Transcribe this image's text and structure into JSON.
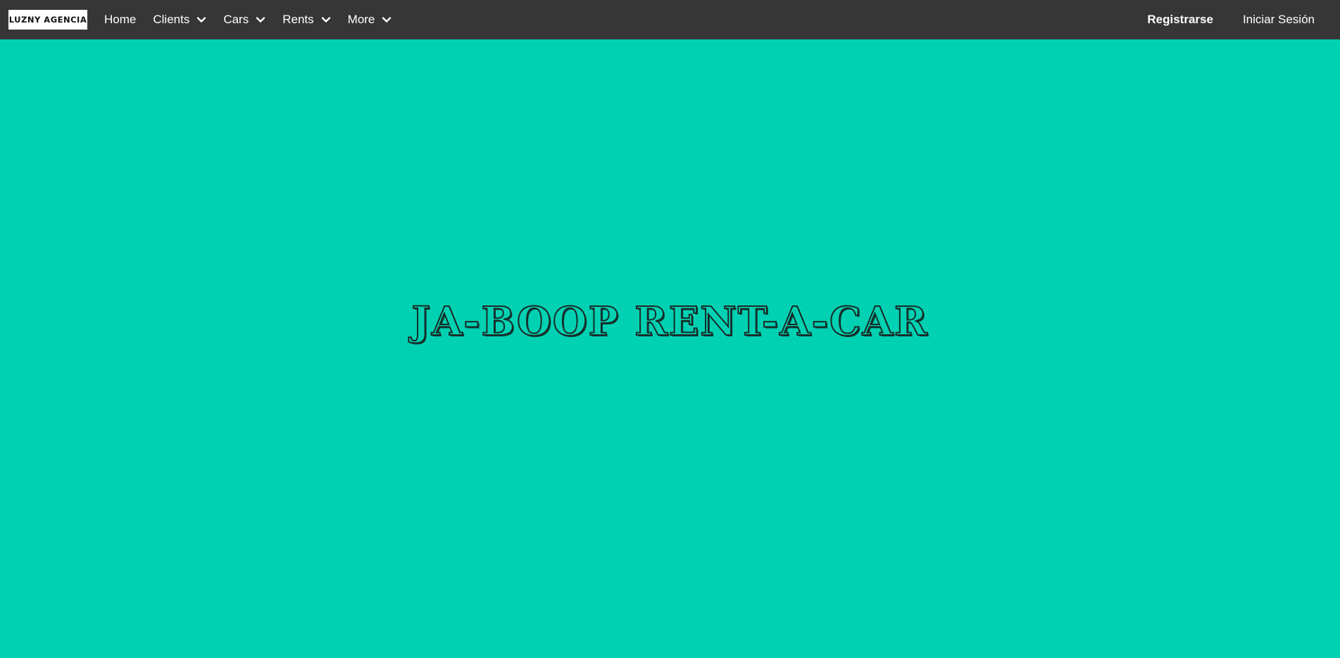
{
  "navbar": {
    "brand_label": "LUZNY AGENCIA",
    "items": [
      {
        "label": "Home",
        "has_dropdown": false
      },
      {
        "label": "Clients",
        "has_dropdown": true,
        "icon": "chevron-down-icon"
      },
      {
        "label": "Cars",
        "has_dropdown": true,
        "icon": "chevron-down-icon"
      },
      {
        "label": "Rents",
        "has_dropdown": true,
        "icon": "chevron-down-icon"
      },
      {
        "label": "More",
        "has_dropdown": true,
        "icon": "chevron-down-icon"
      }
    ],
    "register_label": "Registrarse",
    "login_label": "Iniciar Sesión",
    "background_color": "#363636"
  },
  "hero": {
    "title": "JA-BOOP RENT-A-CAR",
    "background_color": "#00d1b2"
  }
}
